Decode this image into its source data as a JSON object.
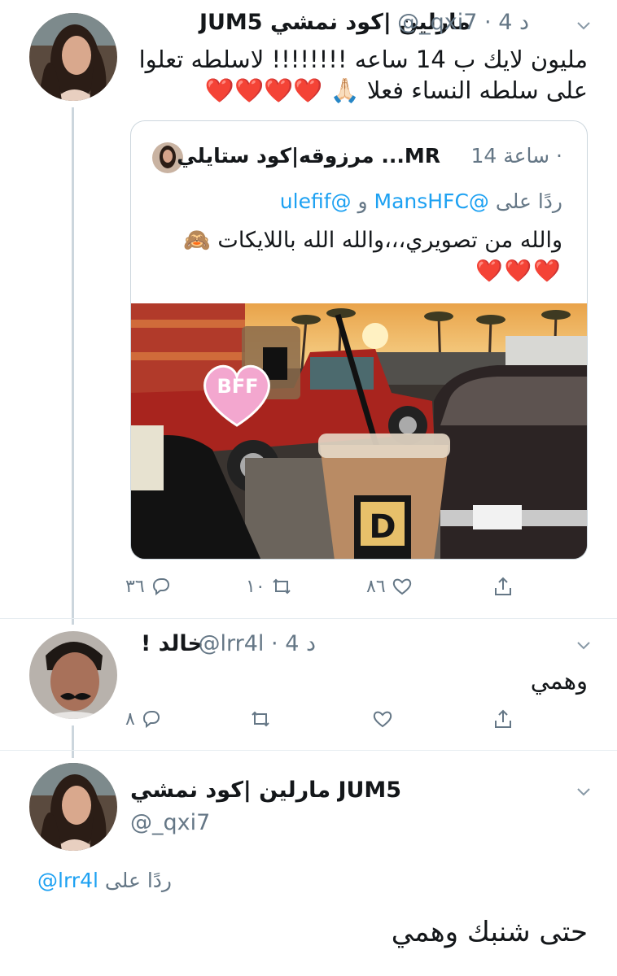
{
  "tweets": [
    {
      "display_name": "مارلين |كود نمشي JUM5",
      "handle": "@_qxi7",
      "time": "4 د",
      "text_line1": "مليون لايك ب 14 ساعه !!!!!!!! لاسلطه تعلوا",
      "text_line2": "على سلطه النساء فعلا 🙏🏻 ❤️❤️❤️❤️"
    },
    {
      "display_name": "خالد !",
      "handle": "@lrr4l",
      "time": "4 د",
      "text": "وهمي"
    },
    {
      "display_name": "مارلين |كود نمشي JUM5",
      "handle": "@_qxi7",
      "reply_prefix": "ردًا على",
      "reply_to": "@lrr4l",
      "text": "حتى شنبك وهمي"
    }
  ],
  "quote": {
    "display_name": "MR... مرزوقه|كود ستايلي",
    "time": "14 ساعة",
    "reply_prefix": "ردًا على",
    "reply_handle_1": "@MansHFC",
    "reply_and": "و",
    "reply_handle_2": "@ulefif",
    "text": "والله من تصويري،،،والله الله باللايكات 🙈",
    "hearts": "❤️❤️❤️",
    "photo_sticker": "BFF",
    "cup_logo": "D"
  },
  "actions_tweet1": {
    "replies": "٣٦",
    "retweets": "١٠",
    "likes": "٨٦"
  },
  "actions_tweet2": {
    "replies": "٨",
    "retweets": "",
    "likes": ""
  },
  "colors": {
    "link": "#1da1f2",
    "secondary": "#657786",
    "border": "#ccd6dd",
    "heart": "#e0245e"
  }
}
